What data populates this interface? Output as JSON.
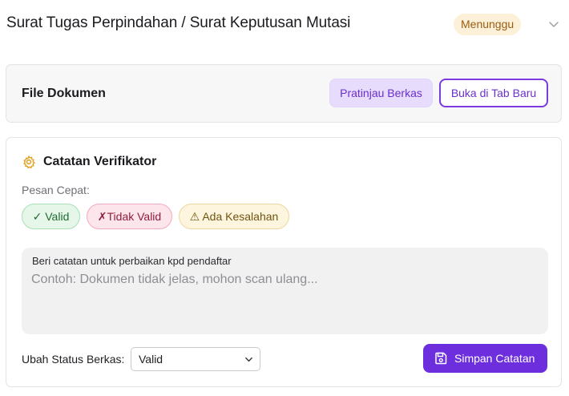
{
  "header": {
    "title": "Surat Tugas Perpindahan / Surat Keputusan Mutasi",
    "status": "Menunggu",
    "expand_icon": "chevron-down-icon"
  },
  "file_section": {
    "label": "File Dokumen",
    "preview_button": "Pratinjau Berkas",
    "open_new_tab_button": "Buka di Tab Baru"
  },
  "notes_section": {
    "icon": "gear-icon",
    "title": "Catatan Verifikator",
    "quick_label": "Pesan Cepat:",
    "quick_messages": [
      {
        "icon": "✓",
        "label": "Valid",
        "display": "✓ Valid"
      },
      {
        "icon": "✗",
        "label": "Tidak Valid",
        "display": "✗Tidak Valid"
      },
      {
        "icon": "⚠",
        "label": "Ada Kesalahan",
        "display": "⚠ Ada Kesalahan"
      }
    ],
    "note_label": "Beri catatan untuk perbaikan kpd pendaftar",
    "note_value": "",
    "note_placeholder": "Contoh: Dokumen tidak jelas, mohon scan ulang...",
    "status_label": "Ubah Status Berkas:",
    "status_selected": "Valid",
    "save_button": "Simpan Catatan",
    "save_icon": "save-icon"
  },
  "colors": {
    "accent": "#6d2fde",
    "status_badge_bg": "#fdf0d8",
    "status_badge_text": "#9a5d12",
    "gear_icon": "#e0a020"
  }
}
